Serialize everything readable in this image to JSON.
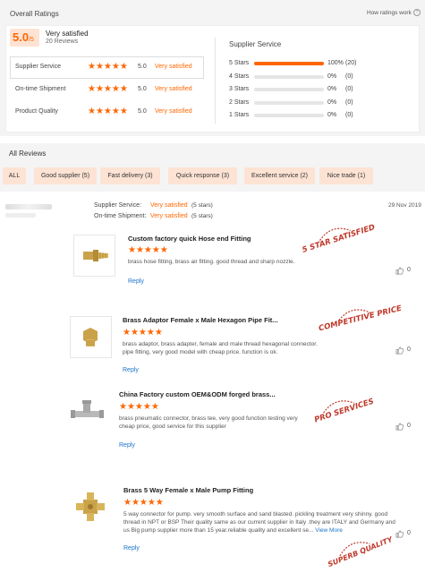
{
  "header": {
    "title": "Overall Ratings",
    "how_link": "How ratings work"
  },
  "overall": {
    "score": "5.0",
    "score_suffix": "/5",
    "label": "Very satisfied",
    "reviews": "20 Reviews"
  },
  "categories": [
    {
      "label": "Supplier Service",
      "score": "5.0",
      "text": "Very satisfied",
      "stars": 5
    },
    {
      "label": "On-time Shipment",
      "score": "5.0",
      "text": "Very satisfied",
      "stars": 5
    },
    {
      "label": "Product Quality",
      "score": "5.0",
      "text": "Very satisfied",
      "stars": 5
    }
  ],
  "supplier_service": {
    "title": "Supplier Service",
    "rows": [
      {
        "label": "5 Stars",
        "pct": "100%",
        "count": "(20)",
        "fill": 1.0
      },
      {
        "label": "4 Stars",
        "pct": "0%",
        "count": "(0)",
        "fill": 0
      },
      {
        "label": "3 Stars",
        "pct": "0%",
        "count": "(0)",
        "fill": 0
      },
      {
        "label": "2 Stars",
        "pct": "0%",
        "count": "(0)",
        "fill": 0
      },
      {
        "label": "1 Stars",
        "pct": "0%",
        "count": "(0)",
        "fill": 0
      }
    ]
  },
  "all_reviews": {
    "title": "All Reviews",
    "filters": [
      "ALL",
      "Good supplier (5)",
      "Fast delivery (3)",
      "Quick response (3)",
      "Excellent service (2)",
      "Nice trade (1)"
    ]
  },
  "review": {
    "date": "29 Nov 2019",
    "supplier_service_label": "Supplier Service:",
    "supplier_service_value": "Very satisfied",
    "supplier_service_stars": "(5 stars)",
    "shipment_label": "On-time Shipment:",
    "shipment_value": "Very satisfied",
    "shipment_stars": "(5 stars)"
  },
  "products": [
    {
      "title": "Custom factory quick Hose end Fitting",
      "desc": "brass hose fitting, brass air fitting. good thread and sharp nozzle.",
      "reply": "Reply",
      "likes": "0",
      "stamp": "5 STAR SATISFIED"
    },
    {
      "title": "Brass Adaptor Female x Male Hexagon Pipe Fit...",
      "desc": "brass adaptor, brass adapter, female and male thread hexagonal connector. pipe fitting, very good model with cheap price. function is ok.",
      "reply": "Reply",
      "likes": "0",
      "stamp": "COMPETITIVE PRICE"
    },
    {
      "title": "China Factory custom OEM&ODM forged brass...",
      "desc": "brass pneumatic connector, brass tee, very good function testing very cheap price, good service for this supplier",
      "reply": "Reply",
      "likes": "0",
      "stamp": "PRO SERVICES"
    },
    {
      "title": "Brass 5 Way Female x Male Pump Fitting",
      "desc": "5 way connector for pump. very smooth surface and sand blasted. pickling treatment very shinny. good thread in NPT or BSP Their quality same as our current supplier in Italy .they are ITALY and Germany and us  Big pump supplier more than 15 year.reliable quality and excellent se...",
      "view_more": "View More",
      "reply": "Reply",
      "likes": "0",
      "stamp": "SUPERB QUALITY"
    }
  ],
  "colors": {
    "accent": "#ff6600",
    "panel": "#f4f4f4",
    "chip": "#fde3d4",
    "link": "#1a73c9",
    "stamp": "#c0392b"
  }
}
